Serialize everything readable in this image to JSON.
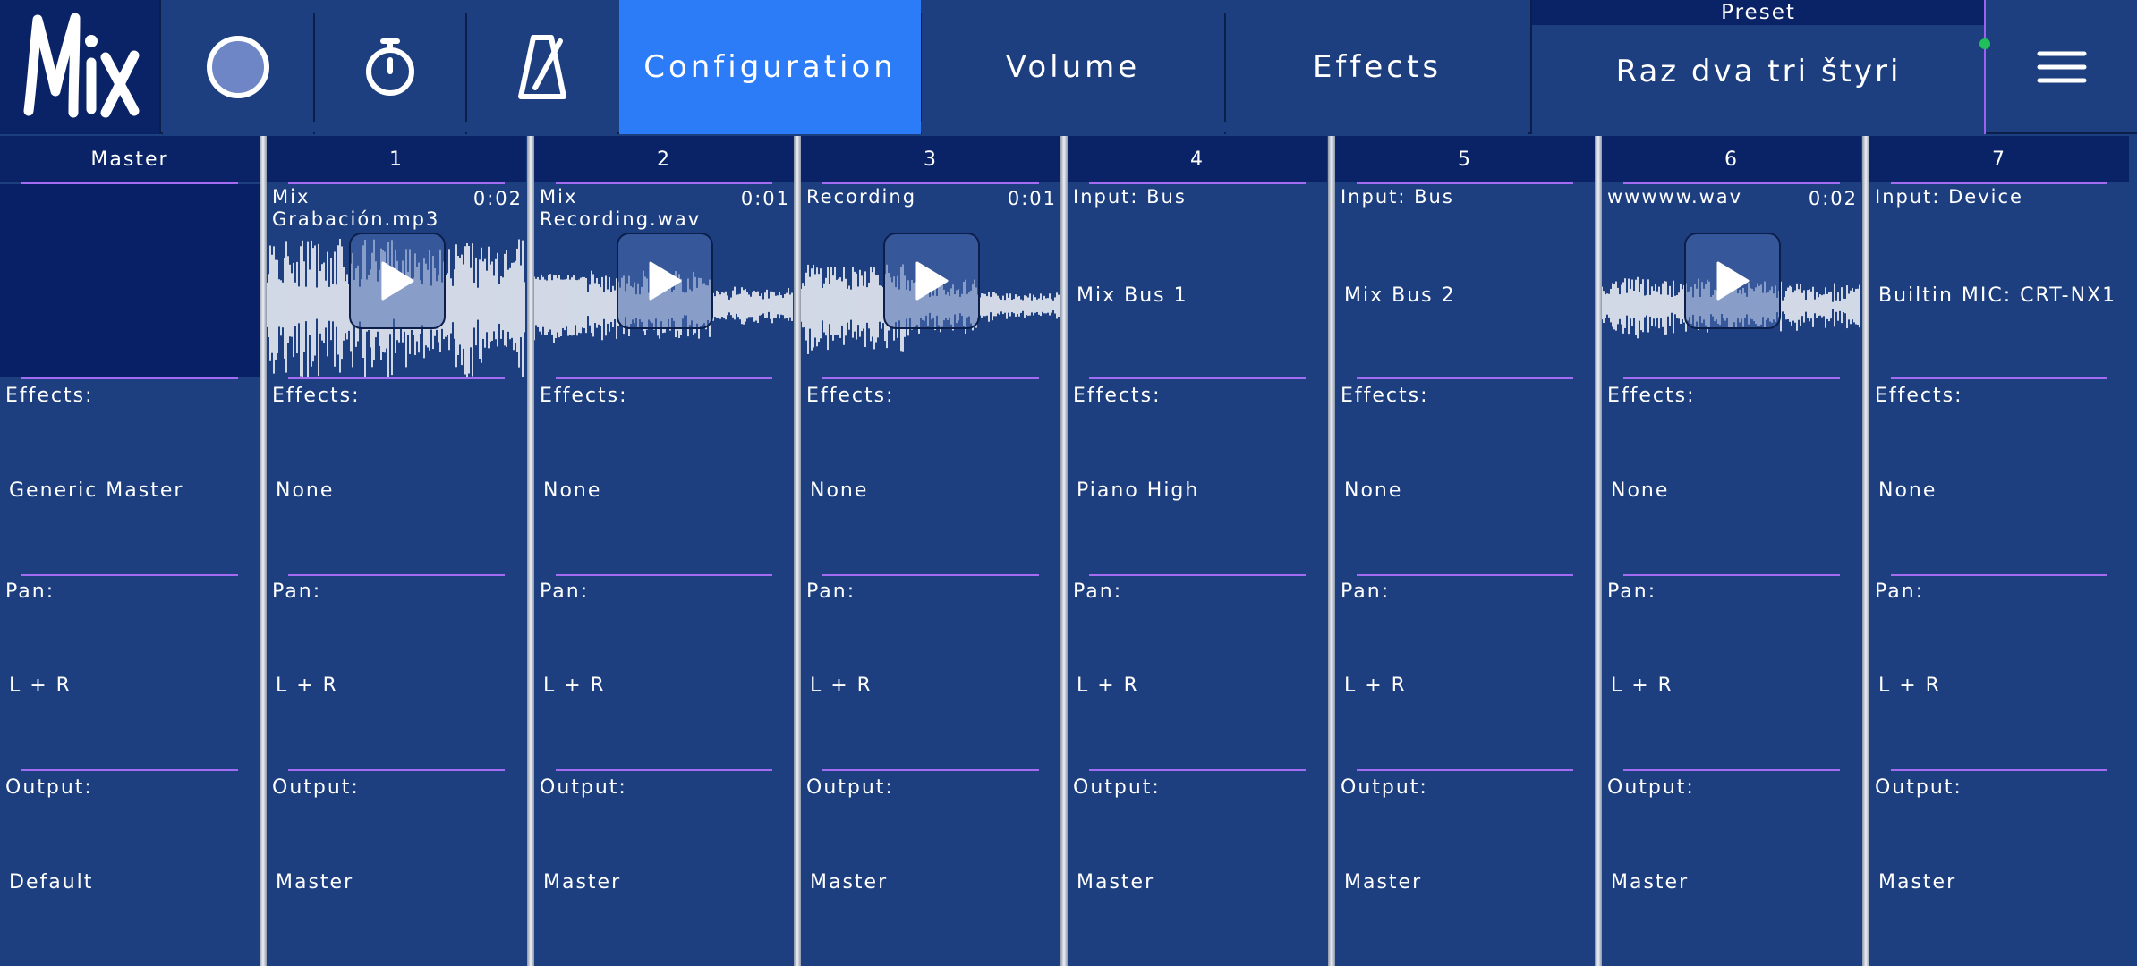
{
  "app": {
    "logo_text": "Mix"
  },
  "toolbar": {
    "record_icon": "record-icon",
    "timer_icon": "stopwatch-icon",
    "metronome_icon": "metronome-icon",
    "tabs": [
      {
        "label": "Configuration",
        "active": true
      },
      {
        "label": "Volume",
        "active": false
      },
      {
        "label": "Effects",
        "active": false
      }
    ],
    "preset_label": "Preset",
    "preset_name": "Raz dva tri štyri",
    "menu_icon": "hamburger-menu-icon"
  },
  "labels": {
    "effects": "Effects:",
    "pan": "Pan:",
    "output": "Output:"
  },
  "channels": [
    {
      "header": "Master",
      "source_title": "",
      "duration": "",
      "source_value": "",
      "effects": "Generic Master",
      "pan": "L + R",
      "output": "Default"
    },
    {
      "header": "1",
      "source_title": "Mix\nGrabación.mp3",
      "duration": "0:02",
      "source_value": "",
      "effects": "None",
      "pan": "L + R",
      "output": "Master"
    },
    {
      "header": "2",
      "source_title": "Mix\nRecording.wav",
      "duration": "0:01",
      "source_value": "",
      "effects": "None",
      "pan": "L + R",
      "output": "Master"
    },
    {
      "header": "3",
      "source_title": "Recording",
      "duration": "0:01",
      "source_value": "",
      "effects": "None",
      "pan": "L + R",
      "output": "Master"
    },
    {
      "header": "4",
      "source_title": "Input: Bus",
      "duration": "",
      "source_value": "Mix Bus 1",
      "effects": "Piano High",
      "pan": "L + R",
      "output": "Master"
    },
    {
      "header": "5",
      "source_title": "Input: Bus",
      "duration": "",
      "source_value": "Mix Bus 2",
      "effects": "None",
      "pan": "L + R",
      "output": "Master"
    },
    {
      "header": "6",
      "source_title": "wwwww.wav",
      "duration": "0:02",
      "source_value": "",
      "effects": "None",
      "pan": "L + R",
      "output": "Master"
    },
    {
      "header": "7",
      "source_title": "Input: Device",
      "duration": "",
      "source_value": "Builtin MIC: CRT-NX1",
      "effects": "None",
      "pan": "L + R",
      "output": "Master"
    }
  ],
  "colors": {
    "background": "#1d3f80",
    "header_dark": "#092366",
    "active_tab": "#2c7cf8",
    "accent_line": "#a46cf2",
    "status_dot": "#21c05a"
  }
}
